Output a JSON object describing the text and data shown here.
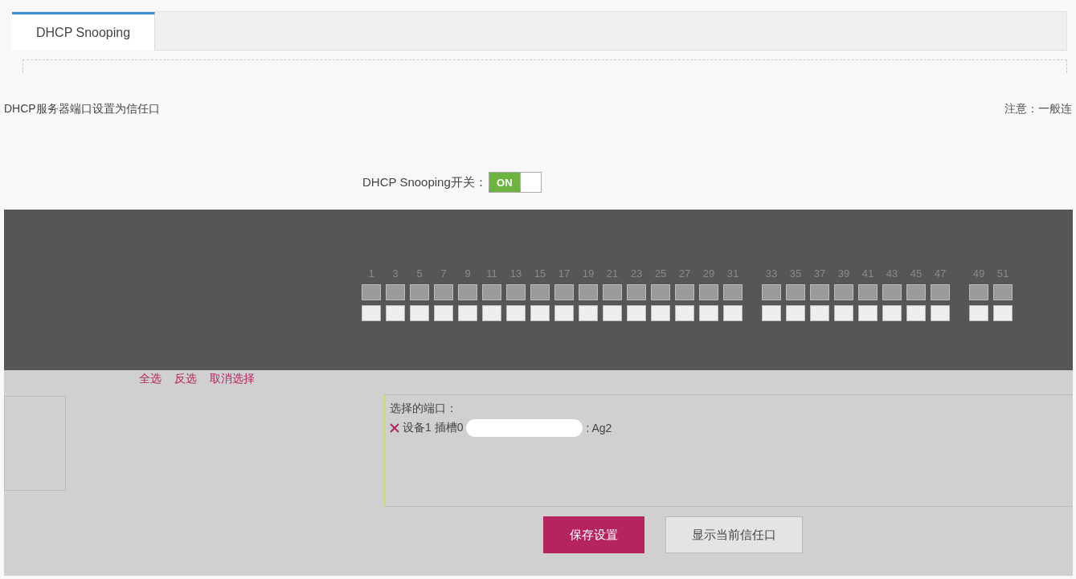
{
  "tabs": [
    {
      "label": "DHCP Snooping",
      "selected": true
    }
  ],
  "notice": {
    "text": "DHCP服务器端口设置为信任口",
    "note": "注意：一般连"
  },
  "snooping_switch": {
    "label": "DHCP Snooping开关：",
    "state_text": "ON",
    "on": true
  },
  "port_panel": {
    "groups": [
      [
        "1",
        "3",
        "5",
        "7",
        "9",
        "11",
        "13",
        "15",
        "17",
        "19",
        "21",
        "23",
        "25",
        "27",
        "29",
        "31"
      ],
      [
        "33",
        "35",
        "37",
        "39",
        "41",
        "43",
        "45",
        "47"
      ],
      [
        "49",
        "51"
      ]
    ]
  },
  "selection_links": [
    "全选",
    "反选",
    "取消选择"
  ],
  "selected_ports": {
    "title": "选择的端口：",
    "items": [
      {
        "device": "设备1 插槽0",
        "port": ": Ag2"
      }
    ]
  },
  "buttons": [
    {
      "label": "保存设置",
      "kind": "primary"
    },
    {
      "label": "显示当前信任口",
      "kind": "secondary"
    }
  ]
}
